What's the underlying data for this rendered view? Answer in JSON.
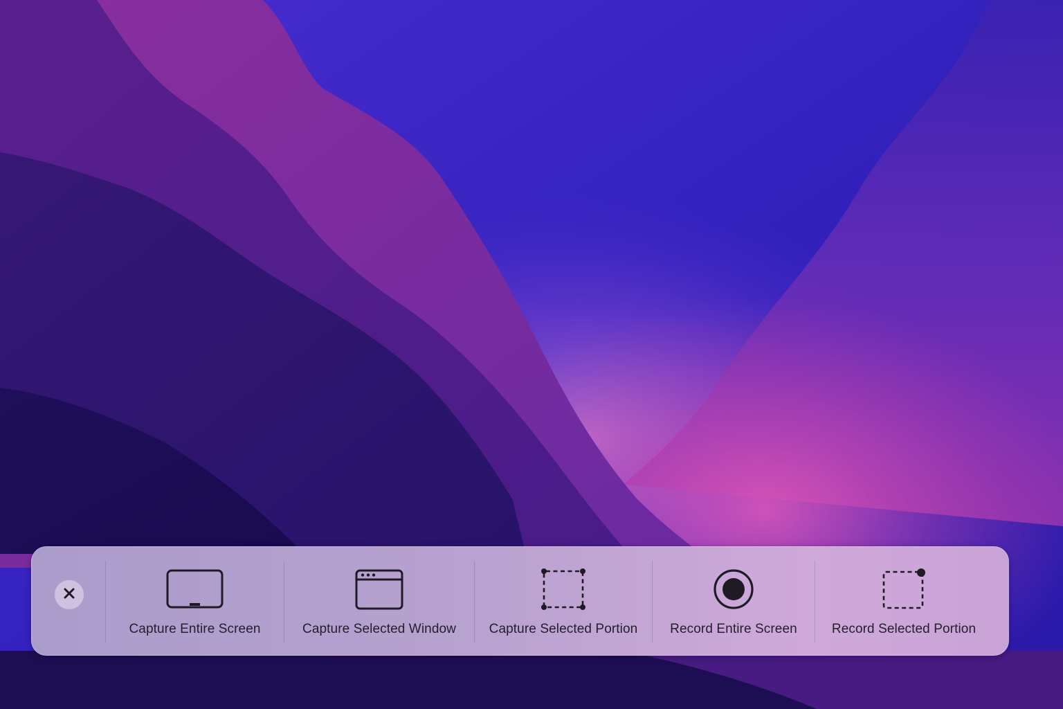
{
  "toolbar": {
    "close_icon": "close-icon",
    "tools": [
      {
        "label": "Capture Entire Screen",
        "icon": "screen-icon"
      },
      {
        "label": "Capture Selected Window",
        "icon": "window-icon"
      },
      {
        "label": "Capture Selected Portion",
        "icon": "selection-icon"
      },
      {
        "label": "Record Entire Screen",
        "icon": "record-icon"
      },
      {
        "label": "Record Selected Portion",
        "icon": "record-selection-icon"
      }
    ]
  },
  "colors": {
    "icon_stroke": "#1e1b25",
    "label_text": "#23202b",
    "toolbar_bg": "#b8a2cf"
  }
}
